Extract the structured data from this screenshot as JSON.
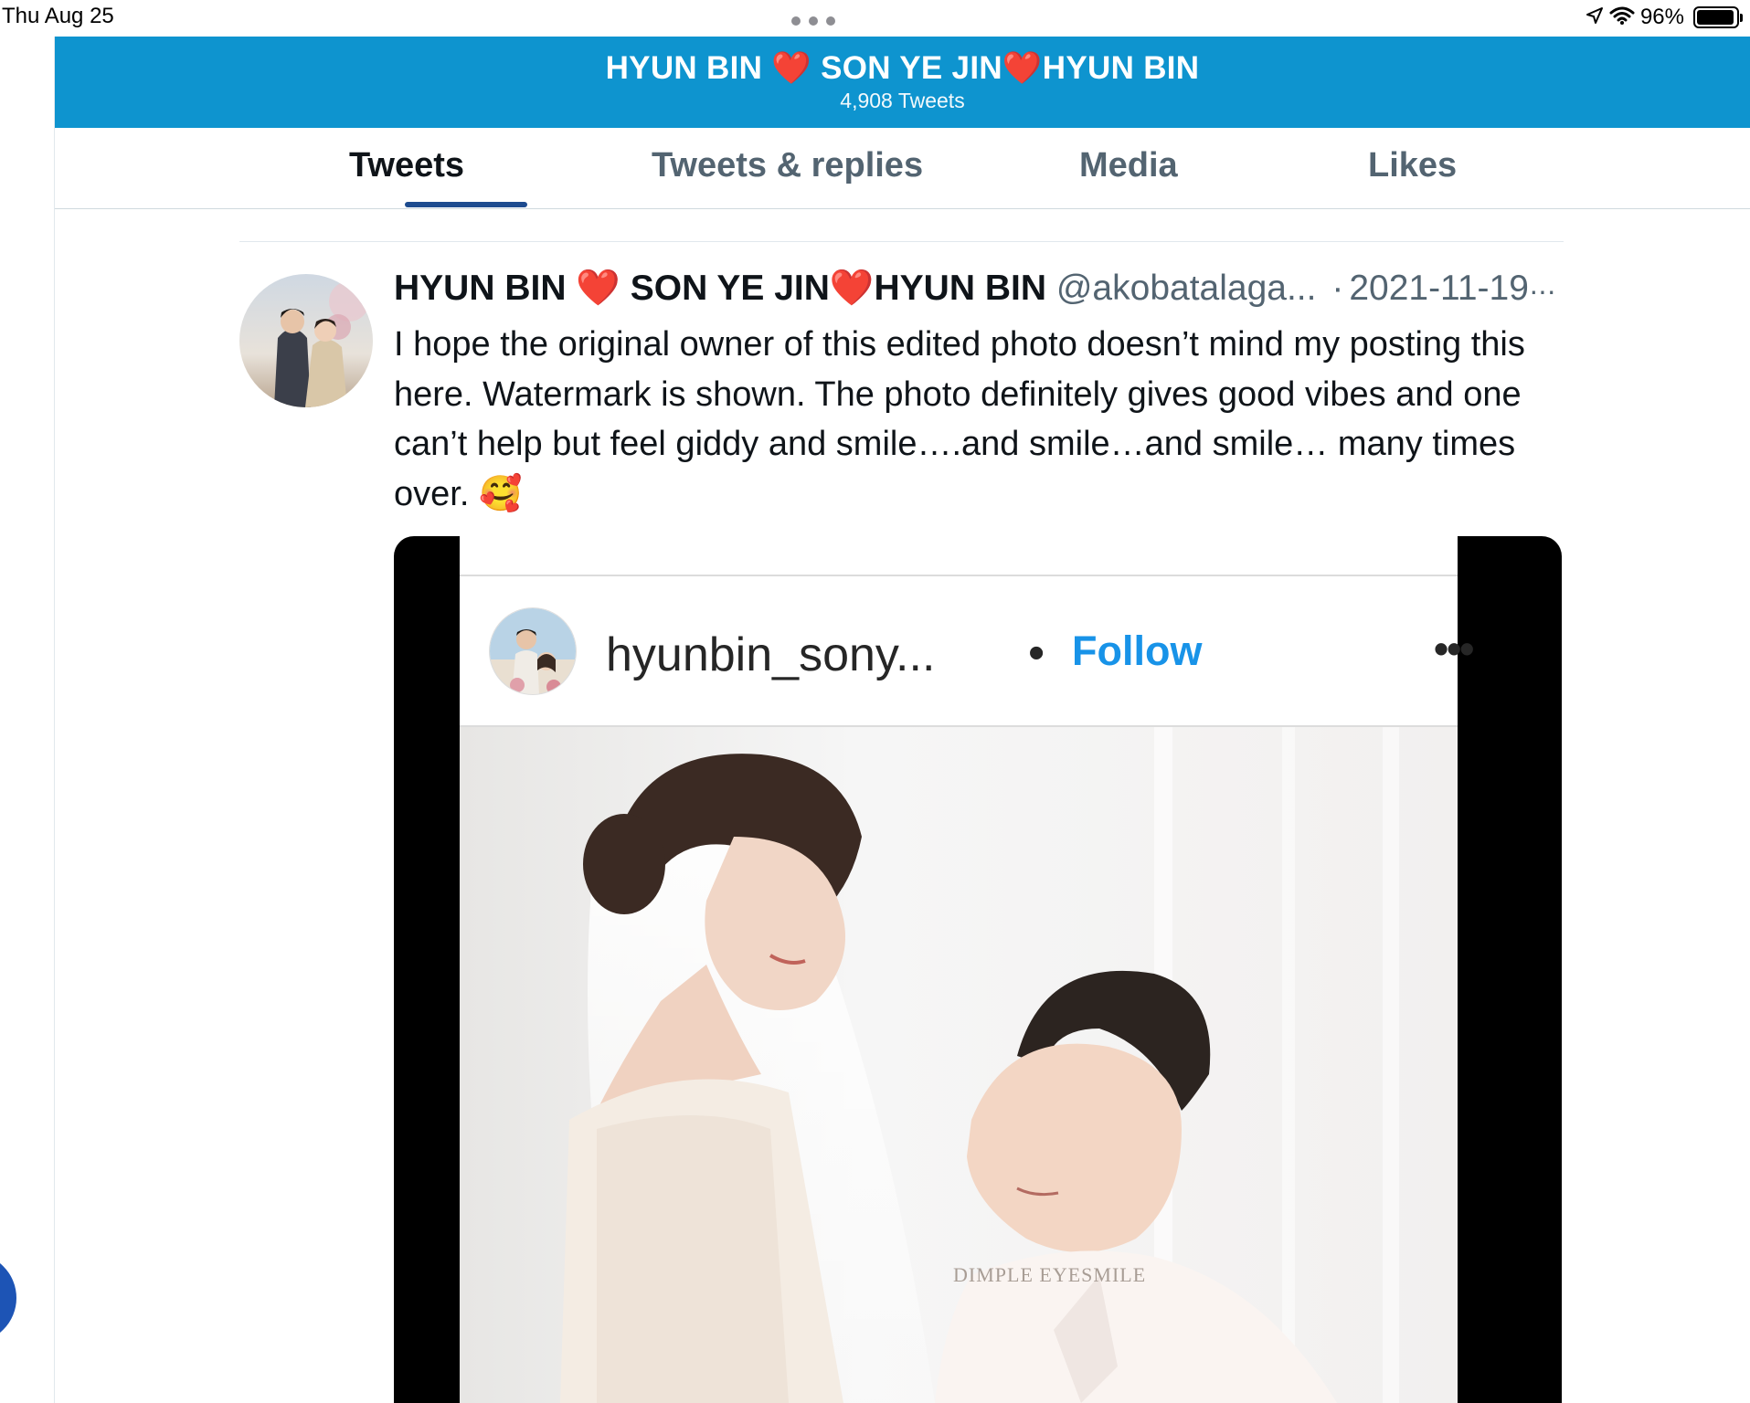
{
  "status_bar": {
    "time": "Thu Aug 25",
    "battery_percent": "96%",
    "battery_level": 0.96
  },
  "header": {
    "title": "HYUN BIN ❤️ SON YE JIN❤️HYUN BIN",
    "tweet_count": "4,908 Tweets",
    "background_color": "#0e94cf"
  },
  "tabs": [
    {
      "label": "Tweets",
      "active": true
    },
    {
      "label": "Tweets & replies",
      "active": false
    },
    {
      "label": "Media",
      "active": false
    },
    {
      "label": "Likes",
      "active": false
    }
  ],
  "tweet": {
    "name": "HYUN BIN ❤️ SON YE JIN❤️HYUN BIN",
    "handle": "@akobatalaga...",
    "separator": "·",
    "date": "2021-11-19",
    "more": "···",
    "text": "I hope the original owner of this edited photo doesn’t mind my posting this here. Watermark is shown. The photo definitely gives good vibes and one can’t help but feel giddy and smile….and smile…and smile… many times over. 🥰",
    "media": {
      "username": "hyunbin_sony...",
      "dot": "•",
      "follow_label": "Follow",
      "more": "•••",
      "watermark": "DIMPLE EYESMILE",
      "follow_color": "#1893e8"
    }
  },
  "icons": [
    "location-arrow-icon",
    "wifi-icon",
    "battery-icon",
    "more-options-icon"
  ]
}
